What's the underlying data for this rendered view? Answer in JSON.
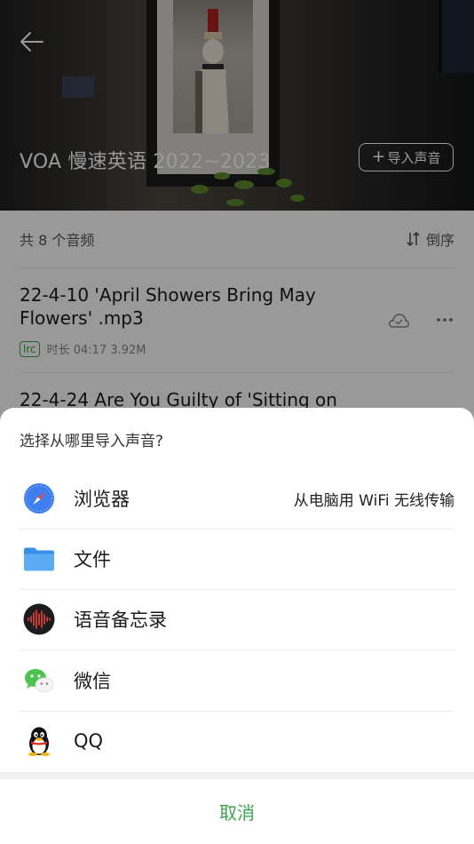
{
  "header": {
    "album_title": "VOA 慢速英语 2022~2023",
    "import_button": "导入声音"
  },
  "list": {
    "count_text": "共 8 个音频",
    "sort_label": "倒序",
    "items": [
      {
        "title": "22-4-10 'April Showers Bring May Flowers' .mp3",
        "badge": "lrc",
        "meta": "时长 04:17 3.92M"
      },
      {
        "title": "22-4-24 Are You Guilty of 'Sitting on"
      }
    ]
  },
  "sheet": {
    "title": "选择从哪里导入声音?",
    "options": [
      {
        "label": "浏览器",
        "icon": "compass-icon",
        "extra": "从电脑用 WiFi 无线传输"
      },
      {
        "label": "文件",
        "icon": "folder-icon"
      },
      {
        "label": "语音备忘录",
        "icon": "voice-memo-icon"
      },
      {
        "label": "微信",
        "icon": "wechat-icon"
      },
      {
        "label": "QQ",
        "icon": "qq-penguin-icon"
      }
    ],
    "cancel": "取消"
  },
  "colors": {
    "accent_green": "#3aa64a",
    "overlay": "rgba(0,0,0,0.4)"
  }
}
